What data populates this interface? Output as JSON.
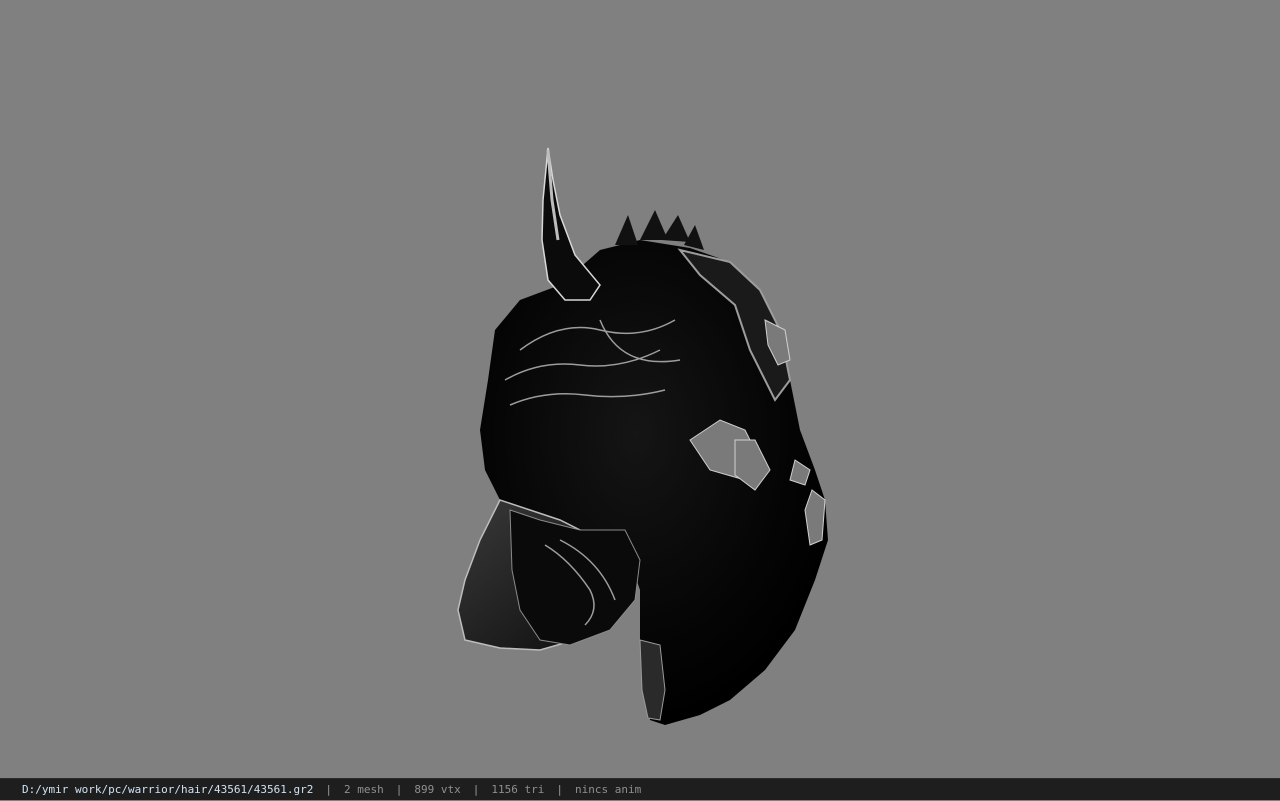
{
  "viewport": {
    "background_color": "#808080",
    "model_description_icon": "helmet-model"
  },
  "status_bar": {
    "file_path": "D:/ymir work/pc/warrior/hair/43561/43561.gr2",
    "mesh_count": "2 mesh",
    "vertex_count": "899 vtx",
    "triangle_count": "1156 tri",
    "anim_status": "nincs anim",
    "separator": "|"
  }
}
